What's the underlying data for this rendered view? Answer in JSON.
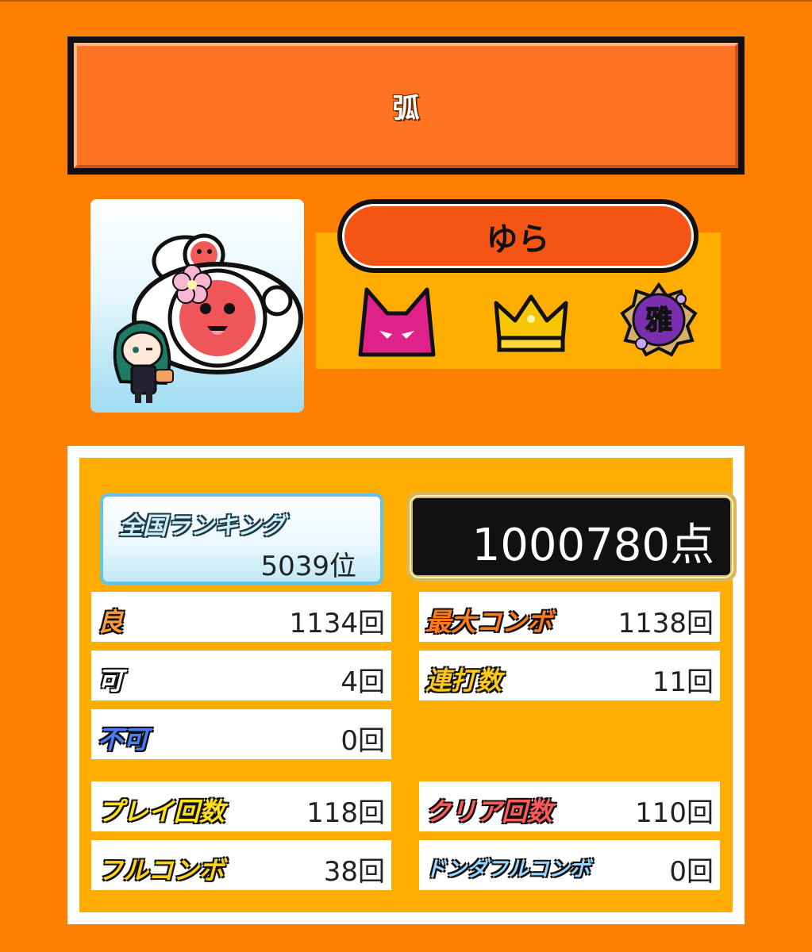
{
  "song": {
    "title": "弧"
  },
  "player": {
    "name": "ゆら",
    "badges": [
      {
        "icon": "oni-difficulty-icon",
        "color": "#e0218a"
      },
      {
        "icon": "gold-crown-icon",
        "color": "#f7c600"
      },
      {
        "icon": "miyabi-rank-icon",
        "label": "雅",
        "color": "#8a3fc2"
      }
    ]
  },
  "result": {
    "ranking_label": "全国ランキング",
    "ranking_value": "5039位",
    "score": "1000780点",
    "stats_left": [
      {
        "label": "良",
        "value": "1134回",
        "color": "#ff9a3c"
      },
      {
        "label": "可",
        "value": "4回",
        "color": "#ffffff"
      },
      {
        "label": "不可",
        "value": "0回",
        "color": "#4a7cff"
      }
    ],
    "stats_right": [
      {
        "label": "最大コンボ",
        "value": "1138回",
        "color": "#ff7a1a"
      },
      {
        "label": "連打数",
        "value": "11回",
        "color": "#ffcb1a"
      }
    ],
    "counts_left": [
      {
        "label": "プレイ回数",
        "value": "118回",
        "color": "#ffe11a"
      },
      {
        "label": "フルコンボ",
        "value": "38回",
        "color": "#ffd21a"
      }
    ],
    "counts_right": [
      {
        "label": "クリア回数",
        "value": "110回",
        "color": "#ff5a5a"
      },
      {
        "label": "ドンダフルコンボ",
        "value": "0回",
        "color": "#9ad6ff"
      }
    ]
  }
}
